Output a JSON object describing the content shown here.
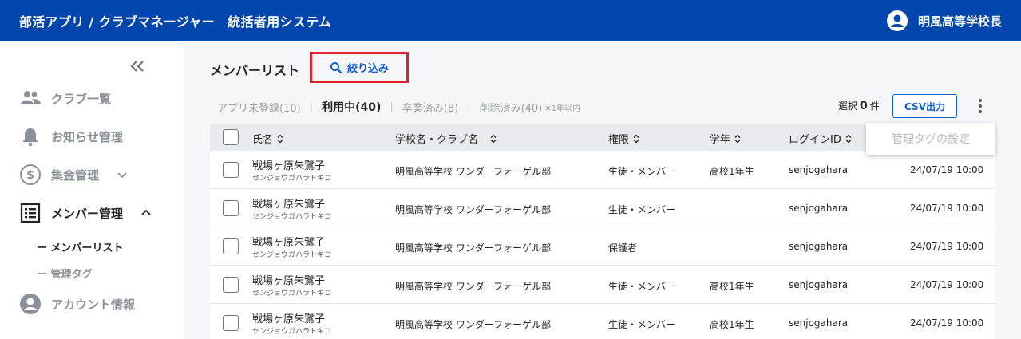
{
  "header": {
    "app_title": "部活アプリ / クラブマネージャー　統括者用システム",
    "user_name": "明風高等学校長"
  },
  "sidebar": {
    "items": [
      {
        "label": "クラブ一覧",
        "icon": "people-icon"
      },
      {
        "label": "お知らせ管理",
        "icon": "bell-icon"
      },
      {
        "label": "集金管理",
        "icon": "dollar-icon",
        "expand": "chevron-down-icon"
      },
      {
        "label": "メンバー管理",
        "icon": "list-icon",
        "expand": "chevron-up-icon"
      },
      {
        "label": "アカウント情報",
        "icon": "account-icon"
      }
    ],
    "sub_items": [
      {
        "label": "ー メンバーリスト"
      },
      {
        "label": "ー 管理タグ"
      }
    ]
  },
  "main": {
    "title": "メンバーリスト",
    "filter_label": "絞り込み",
    "tabs": [
      {
        "label": "アプリ未登録(10)"
      },
      {
        "label": "利用中(40)"
      },
      {
        "label": "卒業済み(8)"
      },
      {
        "label": "削除済み(40)"
      }
    ],
    "tab_note": "※1年以内",
    "selected_prefix": "選択",
    "selected_count": "0",
    "selected_suffix": "件",
    "csv_label": "CSV出力",
    "context_menu_item": "管理タグの設定"
  },
  "table": {
    "columns": [
      "氏名",
      "学校名・クラブ名",
      "権限",
      "学年",
      "ログインID"
    ],
    "rows": [
      {
        "name": "戦場ヶ原朱鷺子",
        "kana": "センジョウガハラトキコ",
        "school": "明風高等学校 ワンダーフォーゲル部",
        "role": "生徒・メンバー",
        "grade": "高校1年生",
        "login": "senjogahara",
        "date": "24/07/19 10:00"
      },
      {
        "name": "戦場ヶ原朱鷺子",
        "kana": "センジョウガハラトキコ",
        "school": "明風高等学校 ワンダーフォーゲル部",
        "role": "生徒・メンバー",
        "grade": "",
        "login": "senjogahara",
        "date": "24/07/19 10:00"
      },
      {
        "name": "戦場ヶ原朱鷺子",
        "kana": "センジョウガハラトキコ",
        "school": "明風高等学校 ワンダーフォーゲル部",
        "role": "保護者",
        "grade": "",
        "login": "senjogahara",
        "date": "24/07/19 10:00"
      },
      {
        "name": "戦場ヶ原朱鷺子",
        "kana": "センジョウガハラトキコ",
        "school": "明風高等学校 ワンダーフォーゲル部",
        "role": "生徒・メンバー",
        "grade": "高校1年生",
        "login": "senjogahara",
        "date": "24/07/19 10:00"
      },
      {
        "name": "戦場ヶ原朱鷺子",
        "kana": "センジョウガハラトキコ",
        "school": "明風高等学校 ワンダーフォーゲル部",
        "role": "生徒・メンバー",
        "grade": "高校1年生",
        "login": "senjogahara",
        "date": "24/07/19 10:00"
      }
    ]
  },
  "colors": {
    "header_bg": "#0046ad",
    "accent": "#0d5bd6",
    "highlight_border": "#e0202a"
  }
}
